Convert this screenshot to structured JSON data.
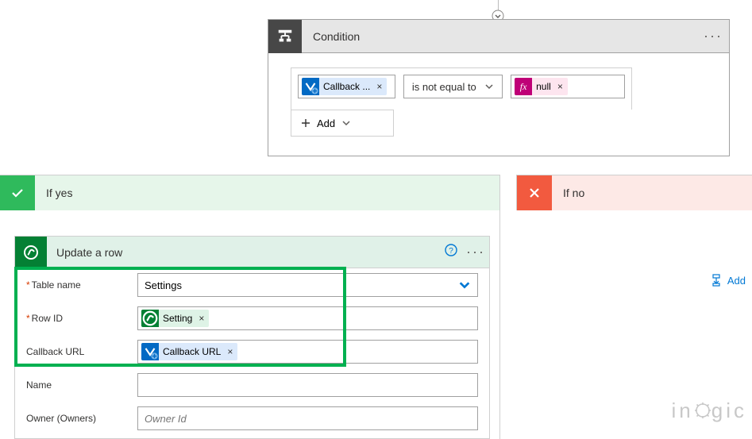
{
  "condition": {
    "title": "Condition",
    "left_token": "Callback ...",
    "operator": "is not equal to",
    "right_token": "null",
    "add_label": "Add"
  },
  "branches": {
    "yes_label": "If yes",
    "no_label": "If no",
    "add_label": "Add"
  },
  "action": {
    "title": "Update a row",
    "fields": {
      "table_name": {
        "label": "Table name",
        "value": "Settings",
        "required": true
      },
      "row_id": {
        "label": "Row ID",
        "token": "Setting",
        "required": true
      },
      "callback": {
        "label": "Callback URL",
        "token": "Callback URL",
        "required": false
      },
      "name": {
        "label": "Name",
        "value": "",
        "required": false
      },
      "owner": {
        "label": "Owner (Owners)",
        "placeholder": "Owner Id",
        "required": false
      }
    }
  },
  "watermark": "in   gic"
}
